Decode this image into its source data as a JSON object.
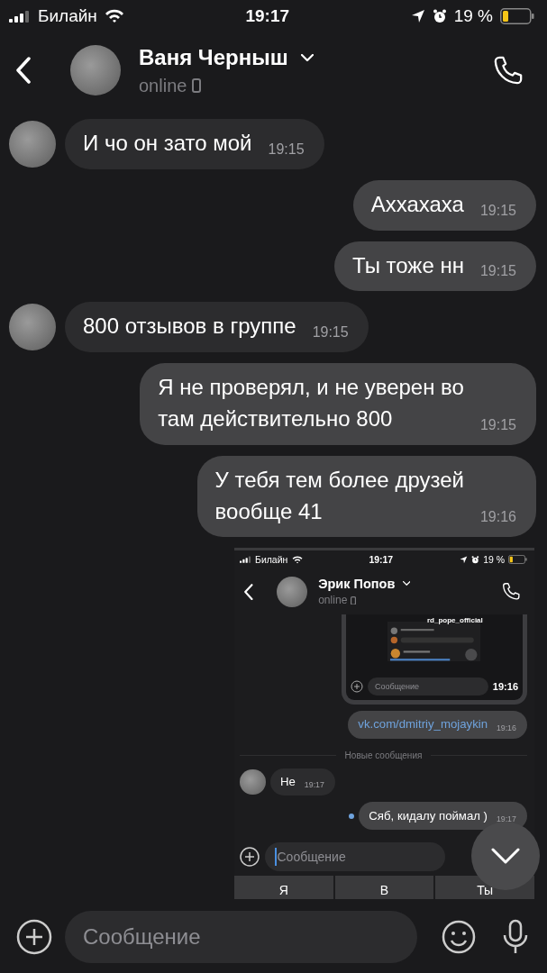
{
  "status_bar": {
    "carrier": "Билайн",
    "time": "19:17",
    "battery": "19 %"
  },
  "header": {
    "name": "Ваня Черныш",
    "status": "online"
  },
  "messages": [
    {
      "kind": "text",
      "outgoing": false,
      "text": "И чо он зато мой",
      "time": "19:15"
    },
    {
      "kind": "text",
      "outgoing": true,
      "text": "Аххахаха",
      "time": "19:15"
    },
    {
      "kind": "text",
      "outgoing": true,
      "text": "Ты тоже нн",
      "time": "19:15"
    },
    {
      "kind": "text",
      "outgoing": false,
      "text": "800 отзывов в группе",
      "time": "19:15"
    },
    {
      "kind": "text",
      "outgoing": true,
      "text": "Я не проверял, и не уверен во\nтам действительно 800",
      "time": "19:15"
    },
    {
      "kind": "text",
      "outgoing": true,
      "text": "У тебя тем более друзей\nвообще 41",
      "time": "19:16"
    },
    {
      "kind": "image",
      "outgoing": true,
      "screenshot": {
        "status_bar": {
          "carrier": "Билайн",
          "time": "19:17",
          "battery": "19 %"
        },
        "header": {
          "name": "Эрик Попов",
          "status": "online"
        },
        "attachment": {
          "title": "rd_pope_official",
          "placeholder": "Сообщение",
          "time": "19:16"
        },
        "messages": [
          {
            "kind": "text",
            "outgoing": true,
            "text": "vk.com/dmitriy_mojaykin",
            "time": "19:16",
            "link": true,
            "unread": false
          },
          {
            "kind": "divider",
            "text": "Новые сообщения"
          },
          {
            "kind": "text",
            "outgoing": false,
            "text": "Не",
            "time": "19:17",
            "link": false,
            "unread": false
          },
          {
            "kind": "text",
            "outgoing": true,
            "text": "Сяб, кидалу поймал )",
            "time": "19:17",
            "link": false,
            "unread": true
          }
        ],
        "input": {
          "placeholder": "Сообщение"
        },
        "suggestions": [
          "Я",
          "В",
          "Ты"
        ]
      }
    }
  ],
  "input": {
    "placeholder": "Сообщение"
  }
}
